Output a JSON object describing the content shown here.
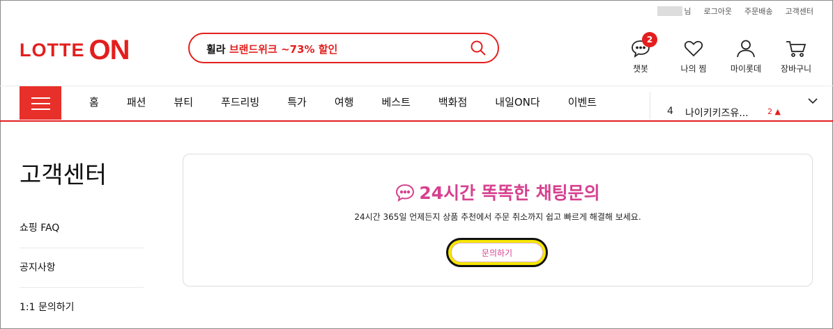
{
  "util_bar": {
    "user_suffix": "님",
    "links": [
      "로그아웃",
      "주문배송",
      "고객센터"
    ]
  },
  "logo": {
    "part1": "LOTTE",
    "part2": "ON"
  },
  "search": {
    "prefix": "휠라",
    "highlight": "브랜드위크 ~73% 할인",
    "icon": "search-icon"
  },
  "header_icons": [
    {
      "label": "챗봇",
      "icon": "chat-bubble-icon",
      "badge": "2"
    },
    {
      "label": "나의 찜",
      "icon": "heart-icon"
    },
    {
      "label": "마이롯데",
      "icon": "person-icon"
    },
    {
      "label": "장바구니",
      "icon": "cart-icon"
    }
  ],
  "nav": {
    "menu_icon": "hamburger-icon",
    "items": [
      "홈",
      "패션",
      "뷰티",
      "푸드리빙",
      "특가",
      "여행",
      "베스트",
      "백화점",
      "내일ON다",
      "이벤트"
    ]
  },
  "ranking": {
    "rank": "4",
    "keyword": "나이키키즈유...",
    "change": "2 ▲",
    "toggle_icon": "chevron-down-icon"
  },
  "sidebar": {
    "title": "고객센터",
    "items": [
      "쇼핑 FAQ",
      "공지사항",
      "1:1 문의하기"
    ]
  },
  "chat_section": {
    "title": "24시간 똑똑한 채팅문의",
    "description": "24시간 365일 언제든지 상품 추천에서 주문 취소까지 쉽고 빠르게 해결해 보세요.",
    "button_label": "문의하기",
    "icon": "chat-dots-icon"
  },
  "colors": {
    "brand_red": "#e31e1e",
    "chat_pink": "#d6418f",
    "highlight_yellow": "#f5e600"
  }
}
